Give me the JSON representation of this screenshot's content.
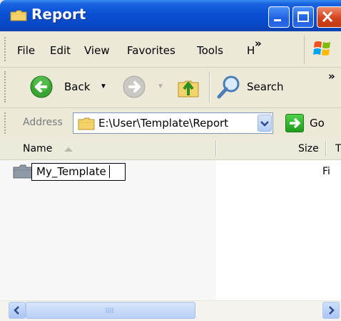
{
  "window": {
    "title": "Report",
    "icon": "folder-icon"
  },
  "title_buttons": {
    "minimize": "minimize-icon",
    "maximize": "maximize-icon",
    "close": "close-icon"
  },
  "menubar": {
    "items": [
      "File",
      "Edit",
      "View",
      "Favorites",
      "Tools",
      "H"
    ],
    "overflow_chevron": "»"
  },
  "toolbar": {
    "back_label": "Back",
    "search_label": "Search",
    "overflow_chevron": "»"
  },
  "address": {
    "label": "Address",
    "value": "E:\\User\\Template\\Report",
    "go_label": "Go"
  },
  "list": {
    "columns": {
      "name": "Name",
      "size": "Size",
      "type": "T"
    },
    "rows": [
      {
        "name_editing": "My_Template",
        "type": "Fi"
      }
    ]
  },
  "colors": {
    "titlebar": "#0a4fd4",
    "address_border": "#7f9db9"
  }
}
